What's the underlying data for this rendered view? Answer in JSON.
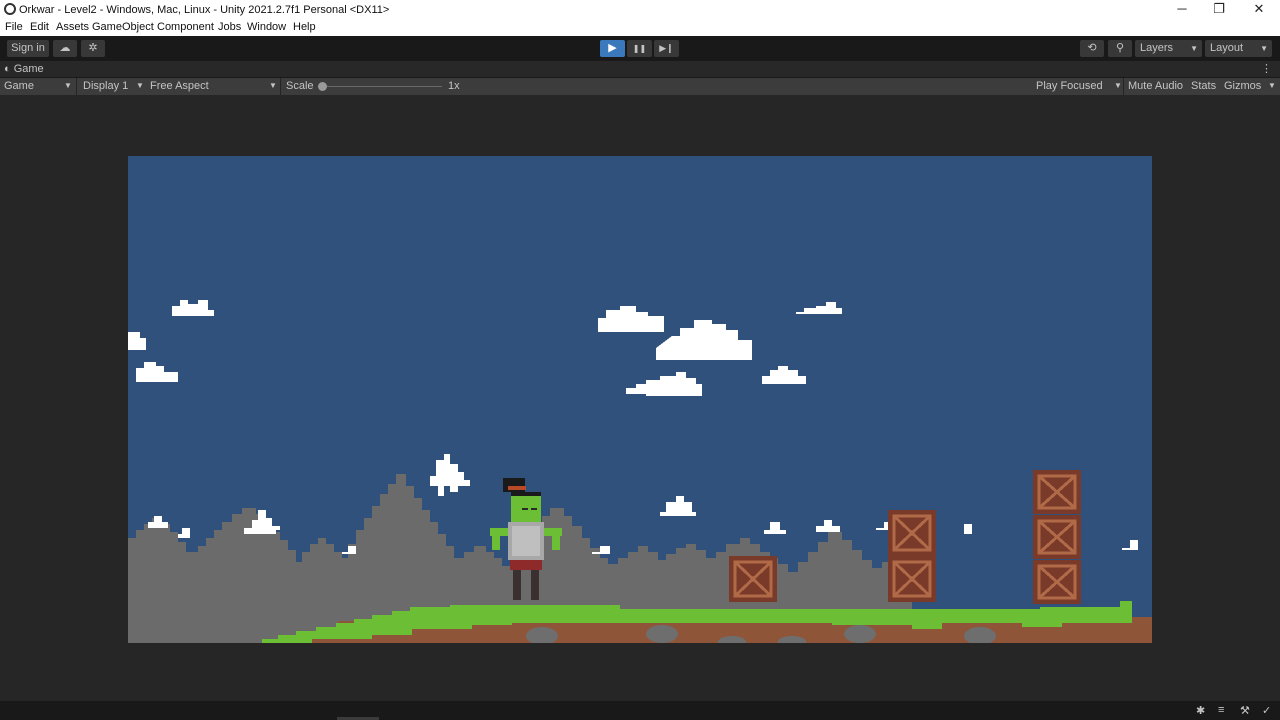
{
  "window": {
    "title": "Orkwar - Level2 - Windows, Mac, Linux - Unity 2021.2.7f1 Personal <DX11>",
    "minimize_glyph": "─",
    "restore_glyph": "❐",
    "close_glyph": "✕"
  },
  "menu": {
    "items": [
      "File",
      "Edit",
      "Assets",
      "GameObject",
      "Component",
      "Jobs",
      "Window",
      "Help"
    ]
  },
  "toolbar": {
    "sign_in": "Sign in",
    "cloud_glyph": "☁",
    "collab_glyph": "✲",
    "play_glyph": "▶",
    "pause_glyph": "❚❚",
    "step_glyph": "▶❙",
    "history_glyph": "⟲",
    "search_glyph": "⚲",
    "layers": "Layers",
    "layout": "Layout",
    "accent": "#3a79bb"
  },
  "tab": {
    "icon_glyph": "◐",
    "label": "Game",
    "menu_glyph": "⋮"
  },
  "game_bar": {
    "view_mode": "Game",
    "display": "Display 1",
    "aspect": "Free Aspect",
    "scale_label": "Scale",
    "scale_value": "1x",
    "play_mode": "Play Focused",
    "mute_audio": "Mute Audio",
    "stats": "Stats",
    "gizmos": "Gizmos"
  },
  "scene": {
    "sky_color": "#31517d",
    "mountain_color": "#6b6b6b",
    "grass_color": "#6cbf34",
    "dirt_color": "#8e5538",
    "crate_color": "#7a3a2a",
    "character": "orc-warrior",
    "crate_count": 6
  },
  "status": {
    "icons": [
      "bug-icon",
      "layers-icon",
      "wrench-icon",
      "check-icon"
    ]
  }
}
